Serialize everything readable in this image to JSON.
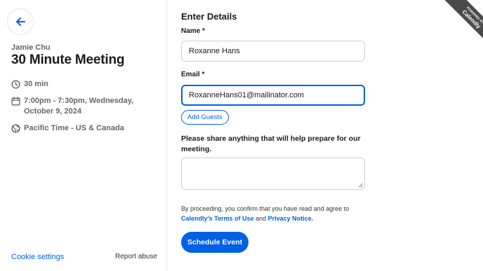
{
  "left_panel": {
    "host_name": "Jamie Chu",
    "event_title": "30 Minute Meeting",
    "duration": "30 min",
    "datetime": "7:00pm - 7:30pm, Wednesday, October 9, 2024",
    "timezone": "Pacific Time - US & Canada",
    "cookie_settings": "Cookie settings",
    "report_abuse": "Report abuse"
  },
  "form": {
    "title": "Enter Details",
    "name_label": "Name *",
    "name_value": "Roxanne Hans",
    "email_label": "Email *",
    "email_value": "RoxanneHans01@mailinator.com",
    "add_guests_label": "Add Guests",
    "prepare_label": "Please share anything that will help prepare for our meeting.",
    "notes_value": "",
    "consent_prefix": "By proceeding, you confirm that you have read and agree to",
    "terms_link": "Calendly's Terms of Use",
    "consent_and": "and",
    "privacy_link": "Privacy Notice.",
    "schedule_button": "Schedule Event"
  },
  "ribbon": {
    "powered_by": "POWERED BY",
    "brand": "Calendly"
  },
  "colors": {
    "accent": "#0060e6",
    "ribbon": "#4a4a4a"
  }
}
